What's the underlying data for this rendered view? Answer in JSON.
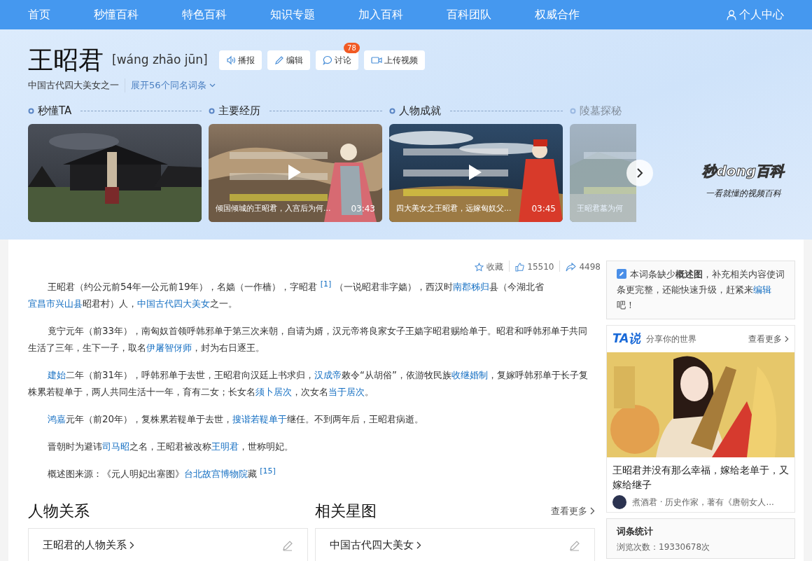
{
  "nav": {
    "items": [
      "首页",
      "秒懂百科",
      "特色百科",
      "知识专题",
      "加入百科",
      "百科团队",
      "权威合作"
    ],
    "user": "个人中心"
  },
  "header": {
    "title": "王昭君",
    "pinyin": "[wáng zhāo jūn]",
    "subtitle": "中国古代四大美女之一",
    "homonyms": "展开56个同名词条",
    "actions": [
      {
        "kind": "speaker",
        "label": "播报"
      },
      {
        "kind": "pencil",
        "label": "编辑"
      },
      {
        "kind": "comment",
        "label": "讨论",
        "badge": "78"
      },
      {
        "kind": "video",
        "label": "上传视频"
      }
    ]
  },
  "videos": [
    {
      "heading": "秒懂TA",
      "faded": false,
      "play": false
    },
    {
      "heading": "主要经历",
      "faded": false,
      "play": true,
      "caption": "倾国倾城的王昭君，入宫后为何...",
      "duration": "03:43"
    },
    {
      "heading": "人物成就",
      "faded": false,
      "play": true,
      "caption": "四大美女之王昭君，远嫁匈奴父...",
      "duration": "03:45"
    },
    {
      "heading": "陵墓探秘",
      "faded": true,
      "play": false,
      "caption": "王昭君墓为何"
    }
  ],
  "video_brand": {
    "logo": "秒dong百科",
    "slogan": "一看就懂的视频百科"
  },
  "toolbar": {
    "favorite": "收藏",
    "likes": "15510",
    "shares": "4498"
  },
  "paragraphs": [
    [
      {
        "kind": "text",
        "t": "王昭君（约公元前54年—公元前19年），名嫱（一作樯），字昭君 "
      },
      {
        "kind": "ref",
        "t": "[1]"
      },
      {
        "kind": "text",
        "t": " （一说昭君非字嫱），西汉时"
      },
      {
        "kind": "link",
        "t": "南郡秭归"
      },
      {
        "kind": "text",
        "t": "县（今湖北省"
      },
      {
        "kind": "link",
        "t": "宜昌市兴山县"
      },
      {
        "kind": "text",
        "t": "昭君村）人，"
      },
      {
        "kind": "link",
        "t": "中国古代四大美女"
      },
      {
        "kind": "text",
        "t": "之一。"
      }
    ],
    [
      {
        "kind": "text",
        "t": "竟宁元年（前33年），南匈奴首领呼韩邪单于第三次来朝，自请为婿，汉元帝将良家女子王嫱字昭君赐给单于。昭君和呼韩邪单于共同生活了三年，生下一子，取名"
      },
      {
        "kind": "link",
        "t": "伊屠智伢师"
      },
      {
        "kind": "text",
        "t": "，封为右日逐王。"
      }
    ],
    [
      {
        "kind": "link",
        "t": "建始"
      },
      {
        "kind": "text",
        "t": "二年（前31年），呼韩邪单于去世，王昭君向汉廷上书求归，"
      },
      {
        "kind": "link",
        "t": "汉成帝"
      },
      {
        "kind": "text",
        "t": "敕令“从胡俗”，依游牧民族"
      },
      {
        "kind": "link",
        "t": "收继婚制"
      },
      {
        "kind": "text",
        "t": "，复嫁呼韩邪单于长子复株累若鞮单于，两人共同生活十一年，育有二女；长女名"
      },
      {
        "kind": "link",
        "t": "须卜居次"
      },
      {
        "kind": "text",
        "t": "，次女名"
      },
      {
        "kind": "link",
        "t": "当于居次"
      },
      {
        "kind": "text",
        "t": "。"
      }
    ],
    [
      {
        "kind": "link",
        "t": "鸿嘉"
      },
      {
        "kind": "text",
        "t": "元年（前20年），复株累若鞮单于去世，"
      },
      {
        "kind": "link",
        "t": "搜谐若鞮单于"
      },
      {
        "kind": "text",
        "t": "继任。不到两年后，王昭君病逝。"
      }
    ],
    [
      {
        "kind": "text",
        "t": "晋朝时为避讳"
      },
      {
        "kind": "link",
        "t": "司马昭"
      },
      {
        "kind": "text",
        "t": "之名，王昭君被改称"
      },
      {
        "kind": "link",
        "t": "王明君"
      },
      {
        "kind": "text",
        "t": "，世称明妃。"
      }
    ],
    [
      {
        "kind": "text",
        "t": "概述图来源：《元人明妃出塞图》"
      },
      {
        "kind": "link",
        "t": "台北故宫博物院"
      },
      {
        "kind": "text",
        "t": "藏 "
      },
      {
        "kind": "ref",
        "t": "[15]"
      }
    ]
  ],
  "relations": [
    {
      "heading": "人物关系",
      "card": "王昭君的人物关系"
    },
    {
      "heading": "相关星图",
      "more": "查看更多",
      "card": "中国古代四大美女"
    }
  ],
  "sidebar": {
    "notice": [
      {
        "kind": "text",
        "t": "本词条缺少"
      },
      {
        "kind": "bold",
        "t": "概述图"
      },
      {
        "kind": "text",
        "t": "，补充相关内容使词条更完整，还能快速升级，赶紧来"
      },
      {
        "kind": "link",
        "t": "编辑"
      },
      {
        "kind": "text",
        "t": "吧！"
      }
    ],
    "ta": {
      "logo": "TA说",
      "tagline": "分享你的世界",
      "more": "查看更多",
      "title": "王昭君并没有那么幸福，嫁给老单于，又嫁给继子",
      "author": "煮酒君 · 历史作家，著有《唐朝女人..."
    },
    "stats": {
      "heading": "词条统计",
      "views": "浏览次数：19330678次"
    }
  }
}
